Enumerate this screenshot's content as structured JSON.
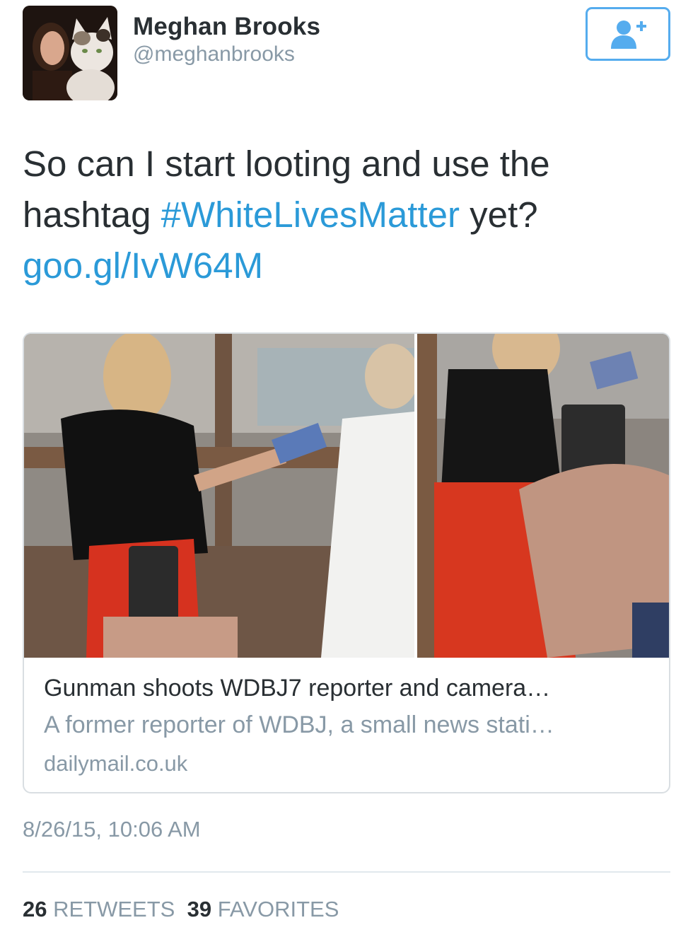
{
  "user": {
    "name": "Meghan Brooks",
    "handle": "@meghanbrooks"
  },
  "tweet": {
    "text_part1": "So can I start looting and use the hashtag ",
    "hashtag": "#WhiteLivesMatter",
    "text_part2": " yet?",
    "link": "goo.gl/IvW64M"
  },
  "card": {
    "title": "Gunman shoots WDBJ7 reporter and camera…",
    "description": "A former reporter of WDBJ, a small news stati…",
    "domain": "dailymail.co.uk"
  },
  "timestamp": "8/26/15, 10:06 AM",
  "stats": {
    "retweets_count": "26",
    "retweets_label": "RETWEETS",
    "favorites_count": "39",
    "favorites_label": "FAVORITES"
  },
  "colors": {
    "link": "#2b9ad8",
    "follow_accent": "#55acee",
    "secondary_text": "#8899a6"
  },
  "icons": {
    "follow": "add-user-icon"
  }
}
